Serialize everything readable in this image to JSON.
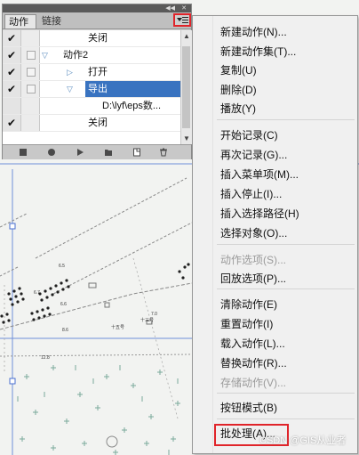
{
  "panel": {
    "tabs": [
      "动作",
      "链接"
    ],
    "rows": [
      {
        "checked": true,
        "dialog": false,
        "indent": "step",
        "twisty": "",
        "label": "关闭"
      },
      {
        "checked": true,
        "dialog": true,
        "indent": "set",
        "twisty": "▽",
        "label": "动作2"
      },
      {
        "checked": true,
        "dialog": true,
        "indent": "step",
        "twisty": "▷",
        "label": "打开"
      },
      {
        "checked": true,
        "dialog": true,
        "indent": "step",
        "twisty": "▽",
        "label": "导出",
        "selected": true
      },
      {
        "checked": false,
        "dialog": false,
        "indent": "param",
        "twisty": "",
        "label": "D:\\lyf\\eps数..."
      },
      {
        "checked": true,
        "dialog": false,
        "indent": "step",
        "twisty": "",
        "label": "关闭"
      }
    ],
    "footer_icons": [
      "stop-icon",
      "record-icon",
      "play-icon",
      "new-set-icon",
      "new-action-icon",
      "delete-icon"
    ]
  },
  "menu": {
    "items": [
      {
        "label": "新建动作(N)...",
        "enabled": true
      },
      {
        "label": "新建动作集(T)...",
        "enabled": true
      },
      {
        "label": "复制(U)",
        "enabled": true
      },
      {
        "label": "删除(D)",
        "enabled": true
      },
      {
        "label": "播放(Y)",
        "enabled": true
      },
      {
        "label": "开始记录(C)",
        "enabled": true
      },
      {
        "label": "再次记录(G)...",
        "enabled": true
      },
      {
        "label": "插入菜单项(M)...",
        "enabled": true
      },
      {
        "label": "插入停止(I)...",
        "enabled": true
      },
      {
        "label": "插入选择路径(H)",
        "enabled": true
      },
      {
        "label": "选择对象(O)...",
        "enabled": true
      },
      {
        "label": "动作选项(S)...",
        "enabled": false
      },
      {
        "label": "回放选项(P)...",
        "enabled": true
      },
      {
        "label": "清除动作(E)",
        "enabled": true
      },
      {
        "label": "重置动作(I)",
        "enabled": true
      },
      {
        "label": "载入动作(L)...",
        "enabled": true
      },
      {
        "label": "替换动作(R)...",
        "enabled": true
      },
      {
        "label": "存储动作(V)...",
        "enabled": false
      },
      {
        "label": "按钮模式(B)",
        "enabled": true
      },
      {
        "label": "批处理(A)...",
        "enabled": true
      }
    ]
  },
  "canvas": {
    "labels": [
      "6.5",
      "6.7",
      "6.6",
      "7.0",
      "十五号",
      "十三号",
      "12.8",
      "8.6"
    ]
  },
  "watermark": "CSDN @GIS从业者",
  "colors": {
    "highlight_box": "#e0242a",
    "selection": "#3973c0"
  }
}
